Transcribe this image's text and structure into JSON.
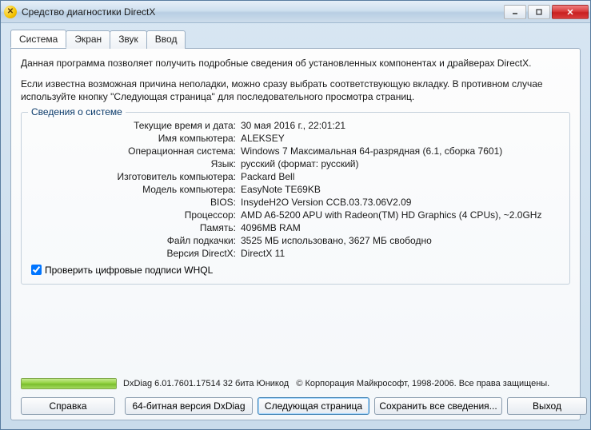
{
  "window": {
    "title": "Средство диагностики DirectX"
  },
  "tabs": [
    {
      "label": "Система",
      "active": true
    },
    {
      "label": "Экран",
      "active": false
    },
    {
      "label": "Звук",
      "active": false
    },
    {
      "label": "Ввод",
      "active": false
    }
  ],
  "intro": {
    "p1": "Данная программа позволяет получить подробные сведения об установленных компонентах и драйверах DirectX.",
    "p2": "Если известна возможная причина неполадки, можно сразу выбрать соответствующую вкладку. В противном случае используйте кнопку \"Следующая страница\" для последовательного просмотра страниц."
  },
  "sysinfo": {
    "title": "Сведения о системе",
    "rows": [
      {
        "label": "Текущие время и дата:",
        "value": "30 мая 2016 г., 22:01:21"
      },
      {
        "label": "Имя компьютера:",
        "value": "ALEKSEY"
      },
      {
        "label": "Операционная система:",
        "value": "Windows 7 Максимальная 64-разрядная (6.1, сборка 7601)"
      },
      {
        "label": "Язык:",
        "value": "русский (формат: русский)"
      },
      {
        "label": "Изготовитель компьютера:",
        "value": "Packard Bell"
      },
      {
        "label": "Модель компьютера:",
        "value": "EasyNote TE69KB"
      },
      {
        "label": "BIOS:",
        "value": "InsydeH2O Version CCB.03.73.06V2.09"
      },
      {
        "label": "Процессор:",
        "value": "AMD A6-5200 APU with Radeon(TM) HD Graphics     (4 CPUs), ~2.0GHz"
      },
      {
        "label": "Память:",
        "value": "4096MB RAM"
      },
      {
        "label": "Файл подкачки:",
        "value": "3525 МБ использовано, 3627 МБ свободно"
      },
      {
        "label": "Версия DirectX:",
        "value": "DirectX 11"
      }
    ],
    "whql_label": "Проверить цифровые подписи WHQL",
    "whql_checked": true
  },
  "footer": {
    "version": "DxDiag 6.01.7601.17514 32 бита Юникод",
    "copyright": "© Корпорация Майкрософт, 1998-2006. Все права защищены."
  },
  "buttons": {
    "help": "Справка",
    "bit64": "64-битная версия DxDiag",
    "next": "Следующая страница",
    "saveall": "Сохранить все сведения...",
    "exit": "Выход"
  }
}
